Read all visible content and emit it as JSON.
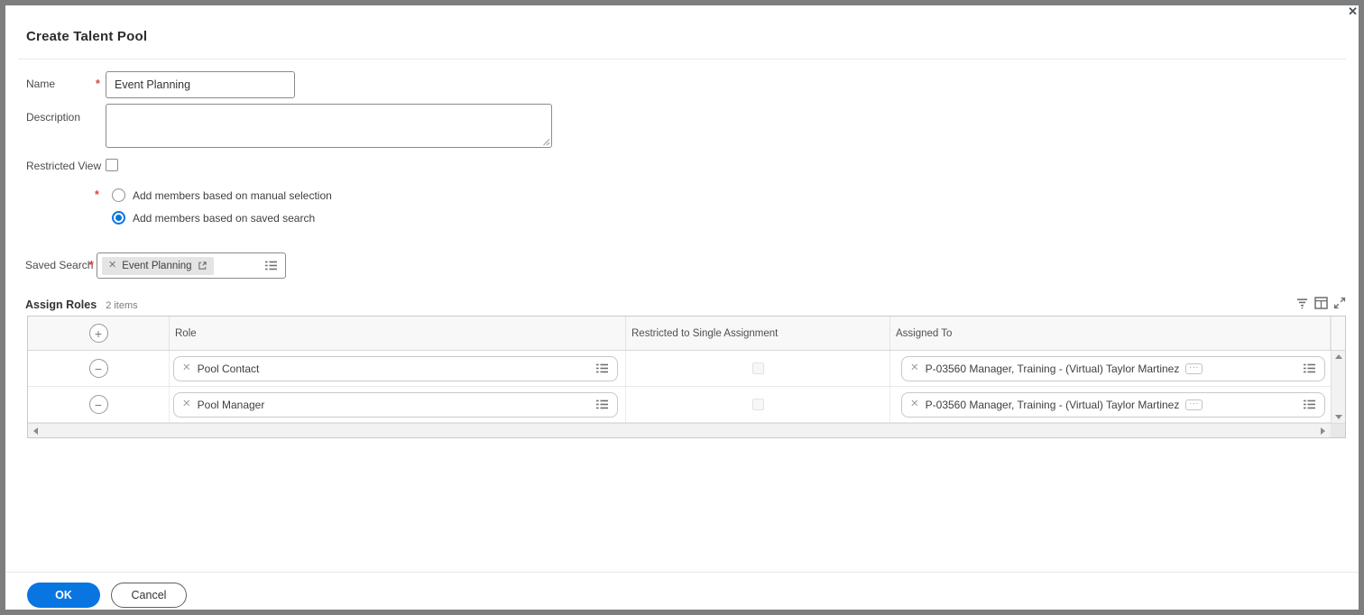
{
  "dialog": {
    "title": "Create Talent Pool",
    "close_glyph": "✕"
  },
  "form": {
    "name": {
      "label": "Name",
      "required": true,
      "value": "Event Planning"
    },
    "description": {
      "label": "Description",
      "value": ""
    },
    "restricted_view": {
      "label": "Restricted View",
      "checked": false
    },
    "member_source": {
      "required": true,
      "options": [
        {
          "label": "Add members based on manual selection",
          "selected": false
        },
        {
          "label": "Add members based on saved search",
          "selected": true
        }
      ]
    },
    "saved_search": {
      "label": "Saved Search",
      "required": true,
      "value": "Event Planning"
    }
  },
  "assign_roles": {
    "title": "Assign Roles",
    "count_label": "2 items",
    "columns": {
      "role": "Role",
      "restricted": "Restricted to Single Assignment",
      "assigned_to": "Assigned To"
    },
    "rows": [
      {
        "role": "Pool Contact",
        "restricted_checked": false,
        "assigned_to": "P-03560 Manager, Training - (Virtual) Taylor Martinez"
      },
      {
        "role": "Pool Manager",
        "restricted_checked": false,
        "assigned_to": "P-03560 Manager, Training - (Virtual) Taylor Martinez"
      }
    ]
  },
  "footer": {
    "ok_label": "OK",
    "cancel_label": "Cancel"
  },
  "glyphs": {
    "remove": "✕",
    "add": "+",
    "subtract": "−",
    "more": "···",
    "required": "*"
  },
  "colors": {
    "accent_blue": "#0875e1",
    "required_red": "#d64541"
  }
}
